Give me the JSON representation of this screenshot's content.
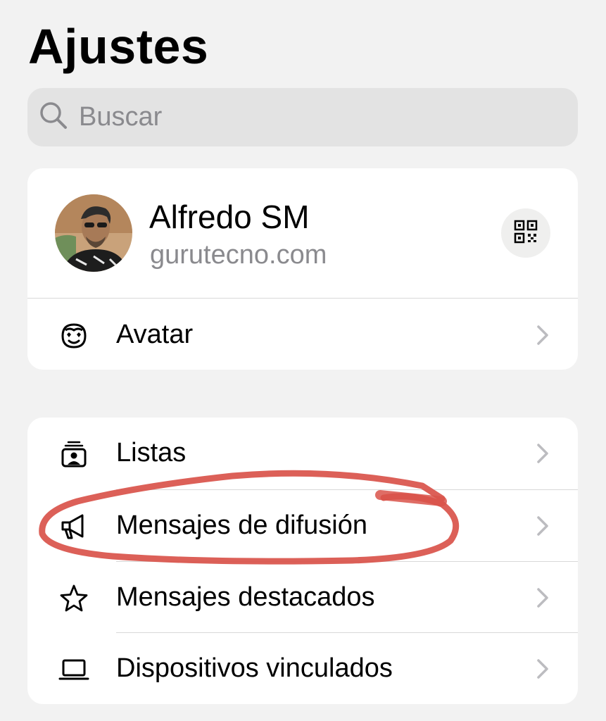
{
  "header": {
    "title": "Ajustes"
  },
  "search": {
    "placeholder": "Buscar",
    "icon": "search-icon"
  },
  "profile": {
    "name": "Alfredo SM",
    "subtitle": "gurutecno.com",
    "qr_icon": "qr-code-icon"
  },
  "profile_card": {
    "items": [
      {
        "label": "Avatar",
        "icon": "avatar-face-icon"
      }
    ]
  },
  "settings_list": {
    "items": [
      {
        "label": "Listas",
        "icon": "lists-icon"
      },
      {
        "label": "Mensajes de difusión",
        "icon": "megaphone-icon"
      },
      {
        "label": "Mensajes destacados",
        "icon": "star-icon"
      },
      {
        "label": "Dispositivos vinculados",
        "icon": "laptop-icon"
      }
    ]
  },
  "colors": {
    "background": "#f2f2f2",
    "card": "#ffffff",
    "secondary_text": "#8a8a8e",
    "annotation_stroke": "#d9534a"
  }
}
